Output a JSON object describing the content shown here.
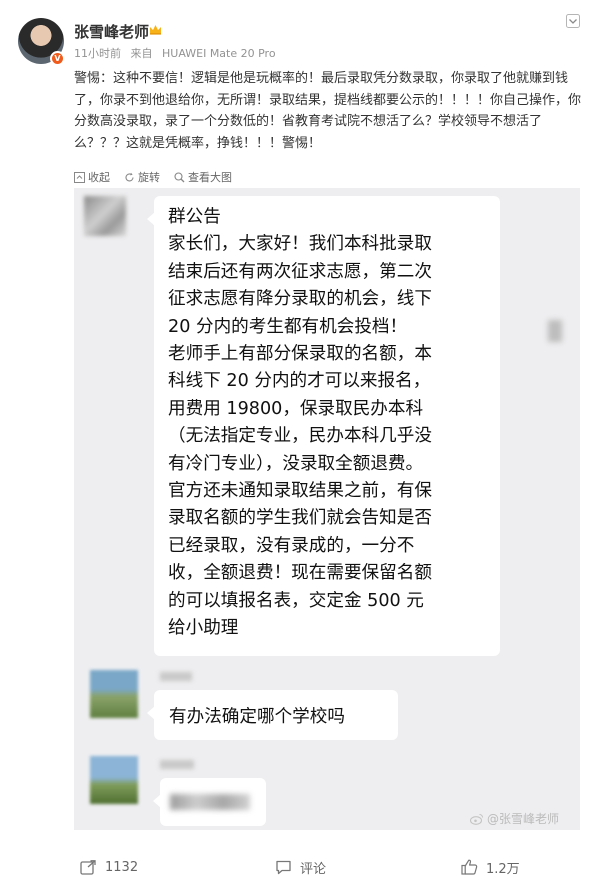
{
  "post": {
    "username": "张雪峰老师",
    "time": "11小时前",
    "source_prefix": "来自",
    "device": "HUAWEI Mate 20 Pro",
    "verified_badge": "V",
    "text": "警惕：这种不要信！逻辑是他是玩概率的！最后录取凭分数录取，你录取了他就赚到钱了，你录不到他退给你，无所谓！录取结果，提档线都要公示的！！！！你自己操作，你分数高没录取，录了一个分数低的！省教育考试院不想活了么？学校领导不想活了么？？？这就是凭概率，挣钱！！！警惕！",
    "icons": {
      "more": "chevron-down-icon",
      "crown": "crown-icon"
    }
  },
  "image_toolbar": {
    "collect": "收起",
    "rotate": "旋转",
    "view_large": "查看大图"
  },
  "chat": {
    "announcement_lines": [
      "群公告",
      "家长们，大家好！我们本科批录取",
      "结束后还有两次征求志愿，第二次",
      "征求志愿有降分录取的机会，线下",
      "20 分内的考生都有机会投档！",
      "老师手上有部分保录取的名额，本",
      "科线下 20 分内的才可以来报名，",
      "用费用 19800，保录取民办本科",
      "（无法指定专业，民办本科几乎没",
      "有冷门专业），没录取全额退费。",
      "官方还未通知录取结果之前，有保",
      "录取名额的学生我们就会告知是否",
      "已经录取，没有录成的，一分不",
      "收，全额退费！现在需要保留名额",
      "的可以填报名表，交定金 500 元",
      "给小助理"
    ],
    "question": "有办法确定哪个学校吗",
    "watermark": "@张雪峰老师"
  },
  "actions": {
    "repost_count": "1132",
    "comment_label": "评论",
    "like_count": "1.2万"
  },
  "colors": {
    "accent_orange": "#f05a1a",
    "meta_gray": "#939393",
    "chat_bg": "#eeeef0"
  }
}
